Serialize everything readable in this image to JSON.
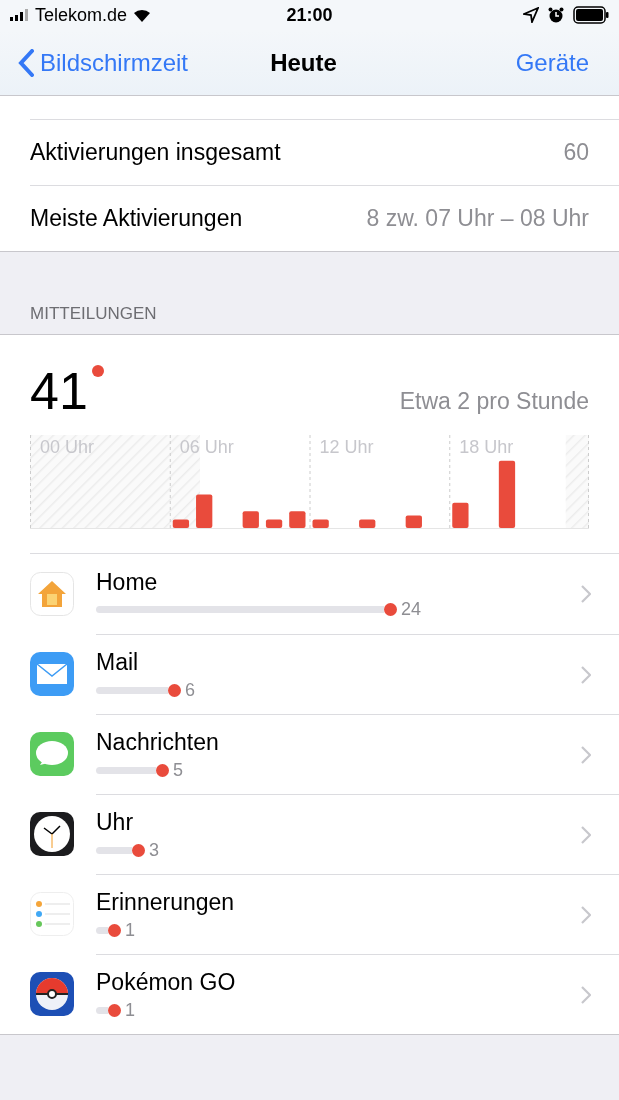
{
  "status_bar": {
    "carrier": "Telekom.de",
    "time": "21:00"
  },
  "nav": {
    "back": "Bildschirmzeit",
    "title": "Heute",
    "action": "Geräte"
  },
  "stats": [
    {
      "label": "Aktivierungen insgesamt",
      "value": "60"
    },
    {
      "label": "Meiste Aktivierungen",
      "value": "8 zw. 07 Uhr – 08 Uhr"
    }
  ],
  "section_header": "MITTEILUNGEN",
  "summary": {
    "total": "41",
    "rate": "Etwa 2 pro Stunde"
  },
  "chart": {
    "hour_labels": [
      "00 Uhr",
      "06 Uhr",
      "12 Uhr",
      "18 Uhr"
    ]
  },
  "apps": [
    {
      "name": "Home",
      "count": "24"
    },
    {
      "name": "Mail",
      "count": "6"
    },
    {
      "name": "Nachrichten",
      "count": "5"
    },
    {
      "name": "Uhr",
      "count": "3"
    },
    {
      "name": "Erinnerungen",
      "count": "1"
    },
    {
      "name": "Pokémon GO",
      "count": "1"
    }
  ]
}
